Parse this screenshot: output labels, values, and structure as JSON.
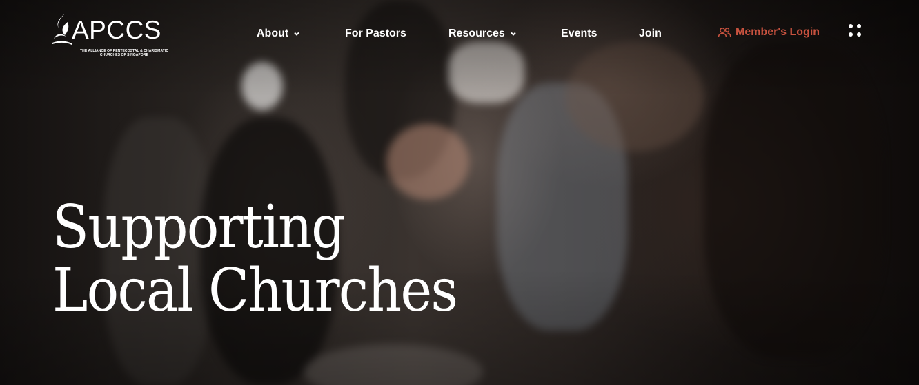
{
  "brand": {
    "name": "APCCS",
    "tagline_line1": "THE ALLIANCE OF PENTECOSTAL & CHARISMATIC",
    "tagline_line2": "CHURCHES OF SINGAPORE"
  },
  "nav": {
    "items": [
      {
        "label": "About",
        "has_dropdown": true
      },
      {
        "label": "For Pastors",
        "has_dropdown": false
      },
      {
        "label": "Resources",
        "has_dropdown": true
      },
      {
        "label": "Events",
        "has_dropdown": false
      },
      {
        "label": "Join",
        "has_dropdown": false
      }
    ],
    "login_label": "Member's Login",
    "menu_icon": "grid-dots-icon"
  },
  "hero": {
    "line1": "Supporting",
    "line2": "Local Churches"
  },
  "colors": {
    "accent": "#c8523f",
    "text": "#ffffff",
    "background": "#1a1614"
  },
  "icons": {
    "logo": "flame-logo-icon",
    "login": "users-icon",
    "dropdown": "chevron-down-icon"
  }
}
